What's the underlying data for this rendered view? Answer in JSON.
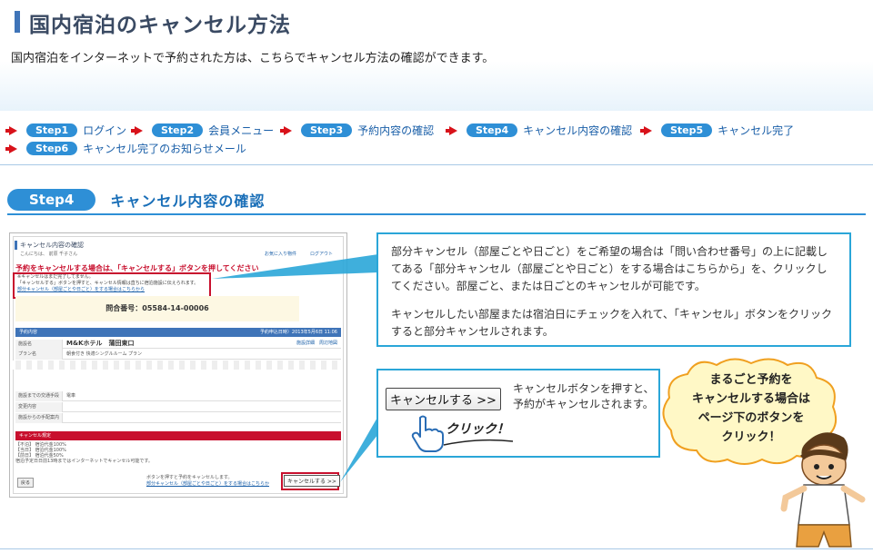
{
  "page": {
    "title": "国内宿泊のキャンセル方法",
    "intro": "国内宿泊をインターネットで予約された方は、こちらでキャンセル方法の確認ができます。"
  },
  "steps": [
    {
      "pill": "Step1",
      "label": "ログイン"
    },
    {
      "pill": "Step2",
      "label": "会員メニュー"
    },
    {
      "pill": "Step3",
      "label": "予約内容の確認"
    },
    {
      "pill": "Step4",
      "label": "キャンセル内容の確認"
    },
    {
      "pill": "Step5",
      "label": "キャンセル完了"
    },
    {
      "pill": "Step6",
      "label": "キャンセル完了のお知らせメール"
    }
  ],
  "section": {
    "pill": "Step4",
    "title": "キャンセル内容の確認"
  },
  "screenshot": {
    "title": "キャンセル内容の確認",
    "greeting": "こんにちは、 前原 千子さん",
    "favorites": "お気に入り物件",
    "logout": "ログアウト",
    "warning": "予約をキャンセルする場合は、「キャンセルする」ボタンを押してください",
    "note_line1": "※キャンセルはまだ完了してません。",
    "note_line2": "「キャンセルする」ボタンを押すと、キャンセル情報は直ちに宿泊施設に伝えられます。",
    "note_link": "部分キャンセル（部屋ごとや日ごと）をする場合はこちらから",
    "inquiry": "問合番号：05584-14-00006",
    "reservation_header": "予約内容",
    "reservation_date": "予約申込日時）2013年5月6日 11:06",
    "rows": [
      {
        "key": "施設名",
        "value": "M&Kホテル　蒲田東口",
        "link": "施設詳細　周辺地図"
      },
      {
        "key": "プラン名",
        "value": "朝食付き 快適シングルルーム プラン"
      }
    ],
    "rows_lower": [
      {
        "key": "施設までの交通手段",
        "value": "電車"
      },
      {
        "key": "変更内容",
        "value": ""
      },
      {
        "key": "施設からの手配案内",
        "value": ""
      }
    ],
    "cancel_header": "キャンセル規定",
    "cancel_rules": [
      "【不泊】 宿泊代金100%",
      "【当日】 宿泊代金100%",
      "【前日】 宿泊代金50%",
      "宿泊予定日日前13時まではインターネットでキャンセル可能です。"
    ],
    "back": "戻る",
    "foot_text": "ボタンを押すと予約をキャンセルします。",
    "foot_link": "部分キャンセル（部屋ごとや日ごと）をする場合はこちらか",
    "cancel_button": "キャンセルする >>"
  },
  "callout1": {
    "para1": "部分キャンセル（部屋ごとや日ごと）をご希望の場合は「問い合わせ番号」の上に記載してある「部分キャンセル（部屋ごとや日ごと）をする場合はこちらから」を、クリックしてください。部屋ごと、または日ごとのキャンセルが可能です。",
    "para2": "キャンセルしたい部屋または宿泊日にチェックを入れて、「キャンセル」ボタンをクリックすると部分キャンセルされます。"
  },
  "callout2": {
    "button": "キャンセルする >>",
    "click": "クリック！",
    "text": "キャンセルボタンを押すと、予約がキャンセルされます。"
  },
  "burst": {
    "line1": "まるごと予約を",
    "line2": "キャンセルする場合は",
    "line3": "ページ下のボタンを",
    "line4": "クリック！"
  },
  "colors": {
    "accent": "#2e8fd6",
    "arrow_red": "#d8121a",
    "title_bar": "#3f74b8",
    "callout_border": "#2aa6d8",
    "warning_red": "#c8102e"
  }
}
